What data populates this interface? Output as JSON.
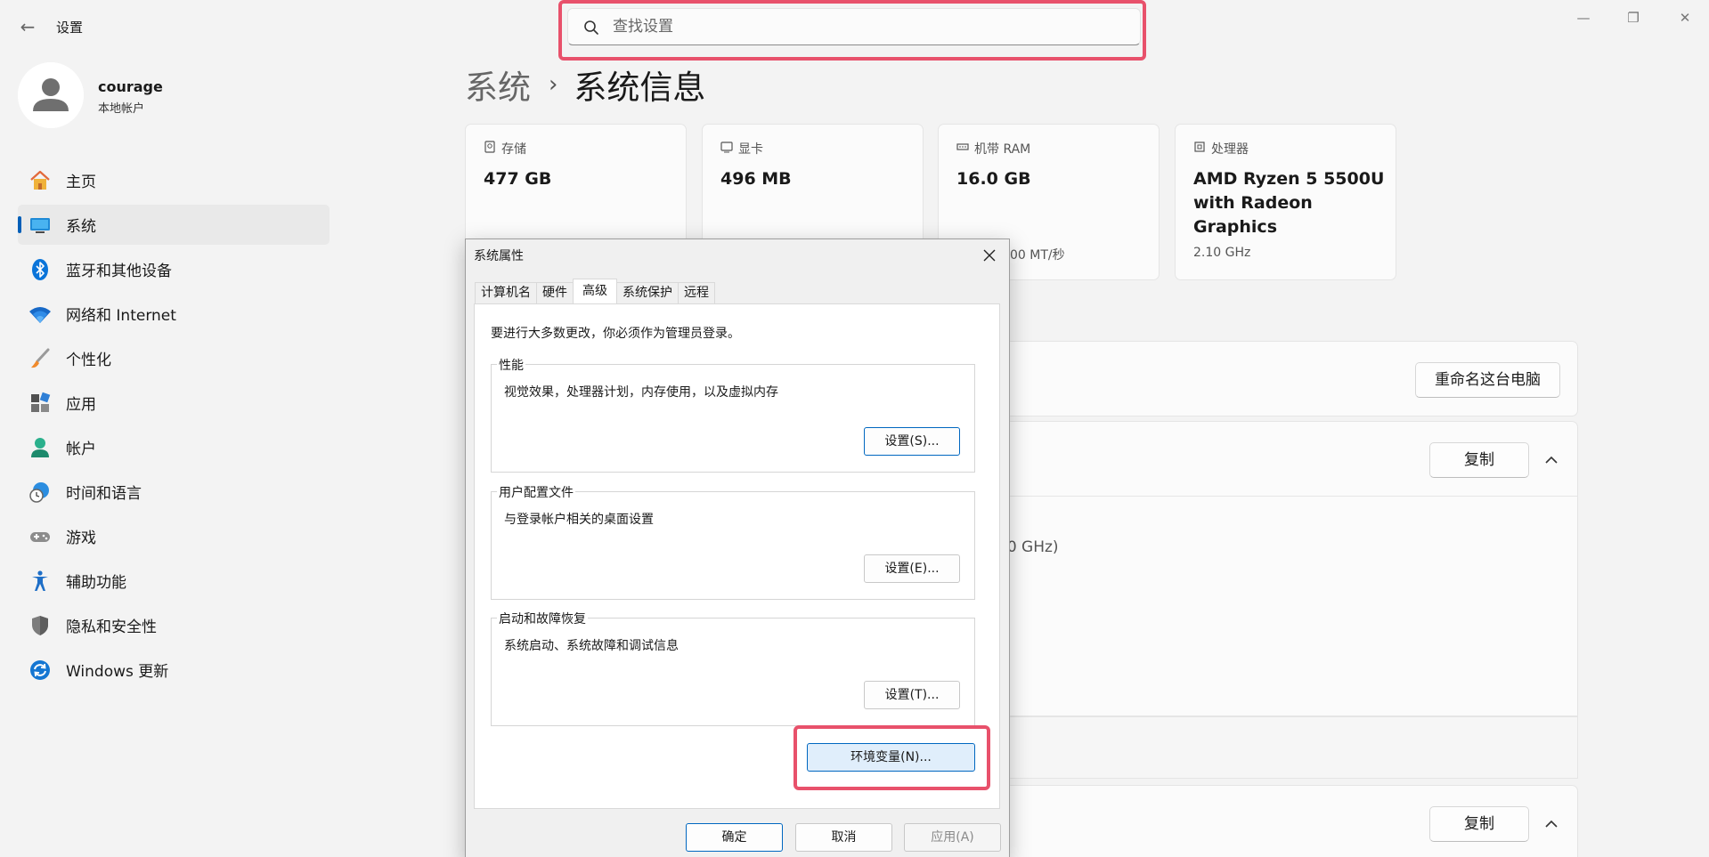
{
  "app": {
    "title": "设置",
    "back_glyph": "←"
  },
  "window_controls": {
    "minimize": "—",
    "maximize": "❐",
    "close": "✕"
  },
  "search": {
    "placeholder": "查找设置"
  },
  "profile": {
    "name": "courage",
    "account_type": "本地帐户"
  },
  "nav": {
    "items": [
      {
        "label": "主页",
        "icon": "home-icon"
      },
      {
        "label": "系统",
        "icon": "system-icon",
        "active": true
      },
      {
        "label": "蓝牙和其他设备",
        "icon": "bluetooth-icon"
      },
      {
        "label": "网络和 Internet",
        "icon": "wifi-icon"
      },
      {
        "label": "个性化",
        "icon": "brush-icon"
      },
      {
        "label": "应用",
        "icon": "apps-icon"
      },
      {
        "label": "帐户",
        "icon": "account-icon"
      },
      {
        "label": "时间和语言",
        "icon": "clock-globe-icon"
      },
      {
        "label": "游戏",
        "icon": "gamepad-icon"
      },
      {
        "label": "辅助功能",
        "icon": "accessibility-icon"
      },
      {
        "label": "隐私和安全性",
        "icon": "shield-icon"
      },
      {
        "label": "Windows 更新",
        "icon": "update-icon"
      }
    ]
  },
  "breadcrumb": {
    "parent": "系统",
    "separator": "›",
    "current": "系统信息"
  },
  "specs": {
    "storage": {
      "label": "存储",
      "value": "477 GB"
    },
    "gpu": {
      "label": "显卡",
      "value": "496 MB"
    },
    "ram": {
      "label": "机带 RAM",
      "value": "16.0 GB",
      "sub": "00 MT/秒"
    },
    "cpu": {
      "label": "处理器",
      "value": "AMD Ryzen 5 5500U with Radeon Graphics",
      "sub": "2.10 GHz"
    }
  },
  "main_buttons": {
    "rename": "重命名这台电脑",
    "copy1": "复制",
    "copy2": "复制"
  },
  "partial_text": "10 GHz)",
  "dialog": {
    "title": "系统属性",
    "tabs": [
      "计算机名",
      "硬件",
      "高级",
      "系统保护",
      "远程"
    ],
    "active_tab": "高级",
    "admin_note": "要进行大多数更改，你必须作为管理员登录。",
    "performance": {
      "title": "性能",
      "desc": "视觉效果，处理器计划，内存使用，以及虚拟内存",
      "button": "设置(S)..."
    },
    "profile": {
      "title": "用户配置文件",
      "desc": "与登录帐户相关的桌面设置",
      "button": "设置(E)..."
    },
    "startup": {
      "title": "启动和故障恢复",
      "desc": "系统启动、系统故障和调试信息",
      "button": "设置(T)..."
    },
    "env_button": "环境变量(N)...",
    "ok": "确定",
    "cancel": "取消",
    "apply": "应用(A)"
  },
  "colors": {
    "accent": "#005fb8",
    "highlight": "#e8516b"
  }
}
